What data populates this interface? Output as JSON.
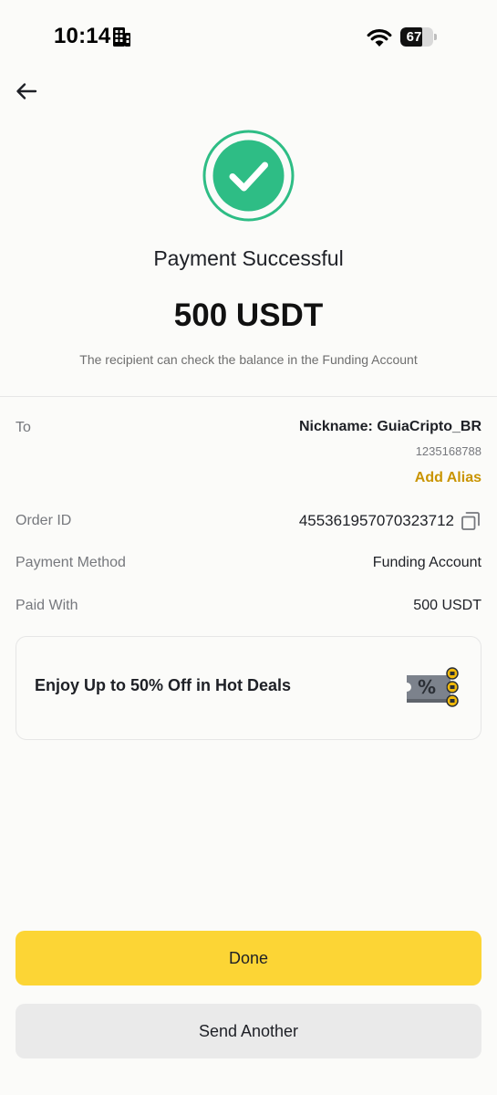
{
  "status_bar": {
    "time": "10:14",
    "battery_level": "67",
    "battery_fraction": 0.67
  },
  "header": {
    "title": "Payment Successful",
    "amount": "500 USDT",
    "subtitle": "The recipient can check the balance in the Funding Account"
  },
  "details": {
    "to_label": "To",
    "nickname": "Nickname: GuiaCripto_BR",
    "account_id": "1235168788",
    "add_alias_label": "Add Alias",
    "order_id_label": "Order ID",
    "order_id_value": "455361957070323712",
    "payment_method_label": "Payment Method",
    "payment_method_value": "Funding Account",
    "paid_with_label": "Paid With",
    "paid_with_value": "500 USDT"
  },
  "promo": {
    "text": "Enjoy Up to 50% Off in Hot Deals",
    "icon": "coupon-icon"
  },
  "buttons": {
    "done_label": "Done",
    "send_another_label": "Send Another"
  },
  "colors": {
    "accent_yellow": "#fcd535",
    "alias_gold": "#c99400",
    "success_green": "#2ebd85",
    "secondary_button": "#eaeaea"
  },
  "icons": {
    "back": "arrow-left-icon",
    "success": "check-circle-icon",
    "copy": "copy-icon",
    "wifi": "wifi-icon",
    "building": "building-icon"
  }
}
